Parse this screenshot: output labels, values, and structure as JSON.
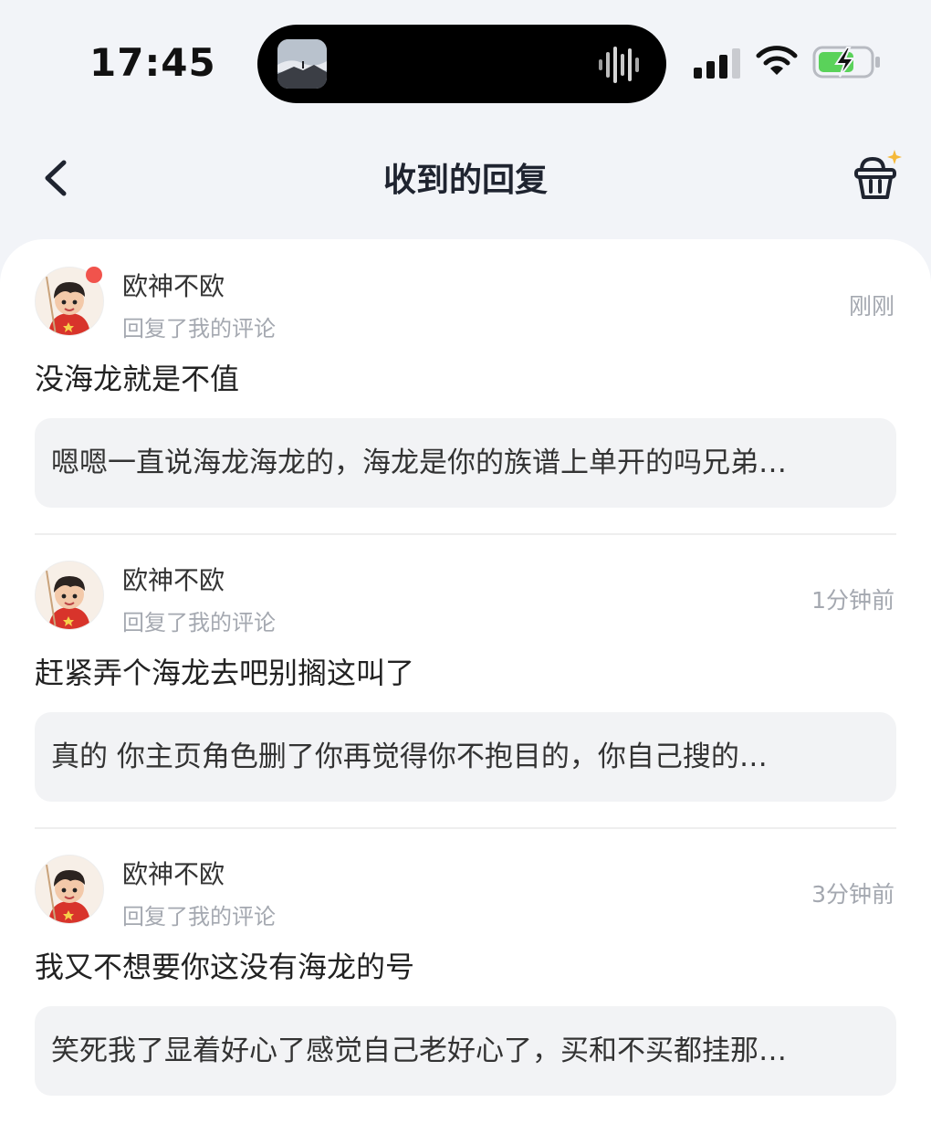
{
  "status_bar": {
    "time": "17:45"
  },
  "header": {
    "title": "收到的回复",
    "back_icon": "chevron-left-icon",
    "clean_icon": "broom-basket-icon"
  },
  "colors": {
    "accent_dot": "#f1534c",
    "battery_green": "#5ad25a"
  },
  "replies": [
    {
      "name": "欧神不欧",
      "action": "回复了我的评论",
      "time": "刚刚",
      "reply": "没海龙就是不值",
      "quote": "嗯嗯一直说海龙海龙的，海龙是你的族谱上单开的吗兄弟…",
      "unread": true
    },
    {
      "name": "欧神不欧",
      "action": "回复了我的评论",
      "time": "1分钟前",
      "reply": "赶紧弄个海龙去吧别搁这叫了",
      "quote": "真的 你主页角色删了你再觉得你不抱目的，你自己搜的…",
      "unread": false
    },
    {
      "name": "欧神不欧",
      "action": "回复了我的评论",
      "time": "3分钟前",
      "reply": "我又不想要你这没有海龙的号",
      "quote": "笑死我了显着好心了感觉自己老好心了，买和不买都挂那…",
      "unread": false
    }
  ]
}
